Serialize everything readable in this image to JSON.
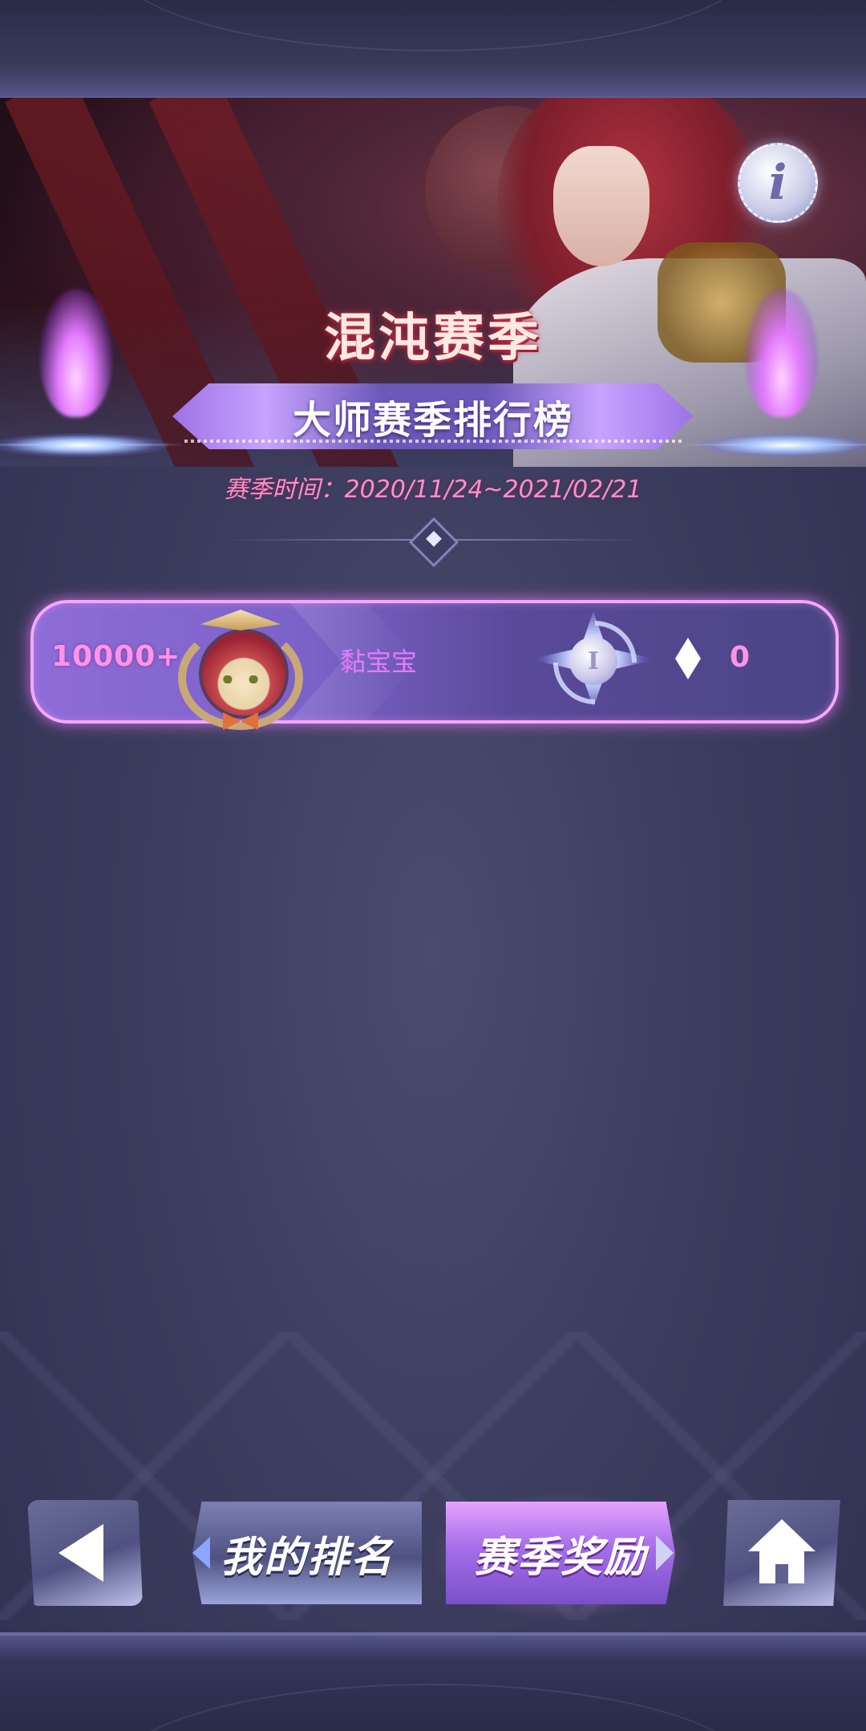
{
  "banner": {
    "season_title": "混沌赛季",
    "ranking_title": "大师赛季排行榜",
    "season_time": "赛季时间：2020/11/24~2021/02/21",
    "info_icon": "info-icon"
  },
  "player_row": {
    "rank": "10000+",
    "name": "黏宝宝",
    "tier_label": "I",
    "score": "0",
    "avatar_icon": "player-avatar",
    "badge_icon": "rank-star-badge-icon",
    "score_icon": "diamond-icon"
  },
  "bottom_bar": {
    "back_icon": "back-arrow-icon",
    "my_rank_label": "我的排名",
    "season_reward_label": "赛季奖励",
    "home_icon": "home-icon"
  },
  "colors": {
    "accent_pink": "#ff93e8",
    "name_purple": "#e47bff",
    "season_time_pink": "#ff8fc7",
    "background": "#3c3d5e"
  }
}
